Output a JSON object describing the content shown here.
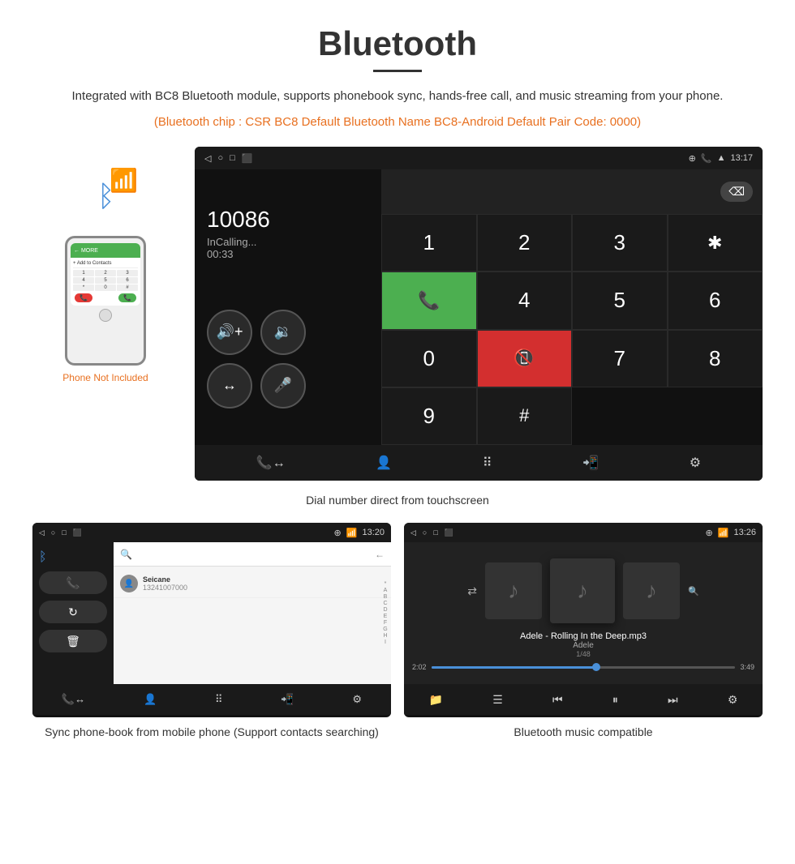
{
  "page": {
    "title": "Bluetooth",
    "description": "Integrated with BC8 Bluetooth module, supports phonebook sync, hands-free call, and music streaming from your phone.",
    "orange_info": "(Bluetooth chip : CSR BC8    Default Bluetooth Name BC8-Android    Default Pair Code: 0000)",
    "phone_not_included": "Phone Not Included",
    "call_screen": {
      "time": "13:17",
      "number": "10086",
      "status": "InCalling...",
      "timer": "00:33",
      "caption": "Dial number direct from touchscreen"
    },
    "phonebook_screen": {
      "time": "13:20",
      "contact_name": "Seicane",
      "contact_number": "13241007000",
      "caption": "Sync phone-book from mobile phone\n(Support contacts searching)"
    },
    "music_screen": {
      "time": "13:26",
      "song_title": "Adele - Rolling In the Deep.mp3",
      "artist": "Adele",
      "track_info": "1/48",
      "time_current": "2:02",
      "time_total": "3:49",
      "caption": "Bluetooth music compatible"
    },
    "alphabet": [
      "*",
      "A",
      "B",
      "C",
      "D",
      "E",
      "F",
      "G",
      "H",
      "I"
    ]
  }
}
